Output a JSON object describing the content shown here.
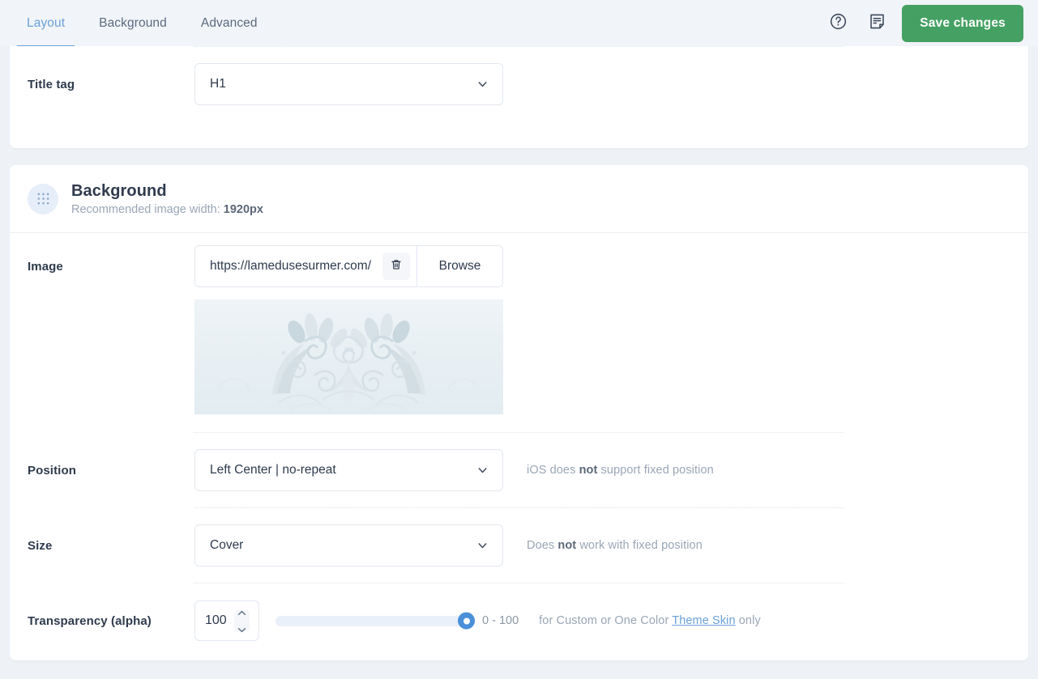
{
  "header": {
    "tabs": [
      {
        "label": "Layout",
        "active": true
      },
      {
        "label": "Background",
        "active": false
      },
      {
        "label": "Advanced",
        "active": false
      }
    ],
    "help_icon": "question-circle-icon",
    "notes_icon": "note-document-icon",
    "save_label": "Save changes",
    "save_color": "#45a163",
    "accent_color": "#6ea3db"
  },
  "title_tag_row": {
    "label": "Title tag",
    "value": "H1"
  },
  "background_section": {
    "icon": "grid-dots-icon",
    "title": "Background",
    "subtitle_prefix": "Recommended image width: ",
    "subtitle_value": "1920px"
  },
  "image_row": {
    "label": "Image",
    "url": "https://lamedusesurmer.com/",
    "placeholder": "https://",
    "delete_icon": "trash-icon",
    "browse_label": "Browse",
    "preview_name": "background-image-preview"
  },
  "position_row": {
    "label": "Position",
    "value": "Left Center | no-repeat",
    "hint_prefix": "iOS does ",
    "hint_bold": "not",
    "hint_suffix": " support fixed position"
  },
  "size_row": {
    "label": "Size",
    "value": "Cover",
    "hint_prefix": "Does ",
    "hint_bold": "not",
    "hint_suffix": " work with fixed position"
  },
  "transparency_row": {
    "label": "Transparency (alpha)",
    "value": "100",
    "range_label": "0 - 100",
    "min": 0,
    "max": 100,
    "hint_prefix": "for Custom or One Color ",
    "hint_link": "Theme Skin",
    "hint_suffix": " only"
  }
}
